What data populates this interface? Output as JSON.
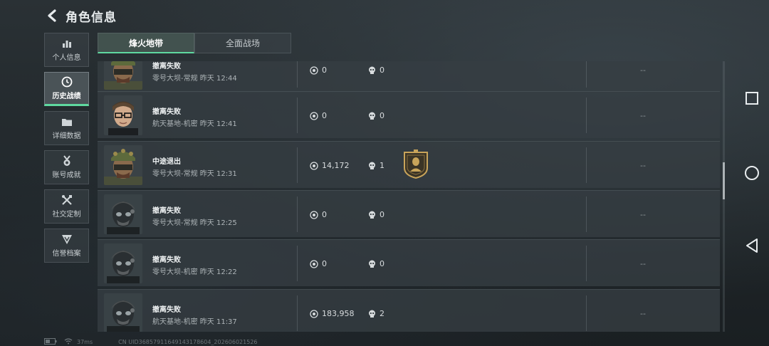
{
  "header": {
    "title": "角色信息",
    "back_icon": "back-chevron-icon"
  },
  "sidebar": {
    "items": [
      {
        "label": "个人信息",
        "icon": "bar-chart-icon",
        "active": false
      },
      {
        "label": "历史战绩",
        "icon": "clock-icon",
        "active": true
      },
      {
        "label": "详细数据",
        "icon": "folder-icon",
        "active": false
      },
      {
        "label": "账号成就",
        "icon": "medal-icon",
        "active": false
      },
      {
        "label": "社交定制",
        "icon": "tools-icon",
        "active": false
      },
      {
        "label": "信誉档案",
        "icon": "shield-badge-icon",
        "active": false
      }
    ]
  },
  "tabs": [
    {
      "label": "烽火地带",
      "active": true
    },
    {
      "label": "全面战场",
      "active": false
    }
  ],
  "records": [
    {
      "result": "撤离失败",
      "map": "零号大坝-常规 昨天 12:44",
      "coins": "0",
      "kills": "0",
      "extra": "--",
      "avatar": "soldier-helmet-avatar",
      "medal": false
    },
    {
      "result": "撤离失败",
      "map": "航天基地-机密 昨天 12:41",
      "coins": "0",
      "kills": "0",
      "extra": "--",
      "avatar": "glasses-operator-avatar",
      "medal": false
    },
    {
      "result": "中途退出",
      "map": "零号大坝-常规 昨天 12:31",
      "coins": "14,172",
      "kills": "1",
      "extra": "--",
      "avatar": "soldier-helmet-avatar",
      "medal": true
    },
    {
      "result": "撤离失败",
      "map": "零号大坝-常规 昨天 12:25",
      "coins": "0",
      "kills": "0",
      "extra": "--",
      "avatar": "masked-operator-avatar",
      "medal": false
    },
    {
      "result": "撤离失败",
      "map": "零号大坝-机密 昨天 12:22",
      "coins": "0",
      "kills": "0",
      "extra": "--",
      "avatar": "masked-operator-avatar",
      "medal": false
    },
    {
      "result": "撤离失败",
      "map": "航天基地-机密 昨天 11:37",
      "coins": "183,958",
      "kills": "2",
      "extra": "--",
      "avatar": "masked-operator-avatar",
      "medal": false
    }
  ],
  "footer": {
    "ping": "37ms",
    "uid": "CN UID3685791164914317860​4_20260602​1526"
  },
  "colors": {
    "accent": "#5fd9a0",
    "row_bg": "#363e42",
    "medal_gold": "#c9a45a"
  }
}
